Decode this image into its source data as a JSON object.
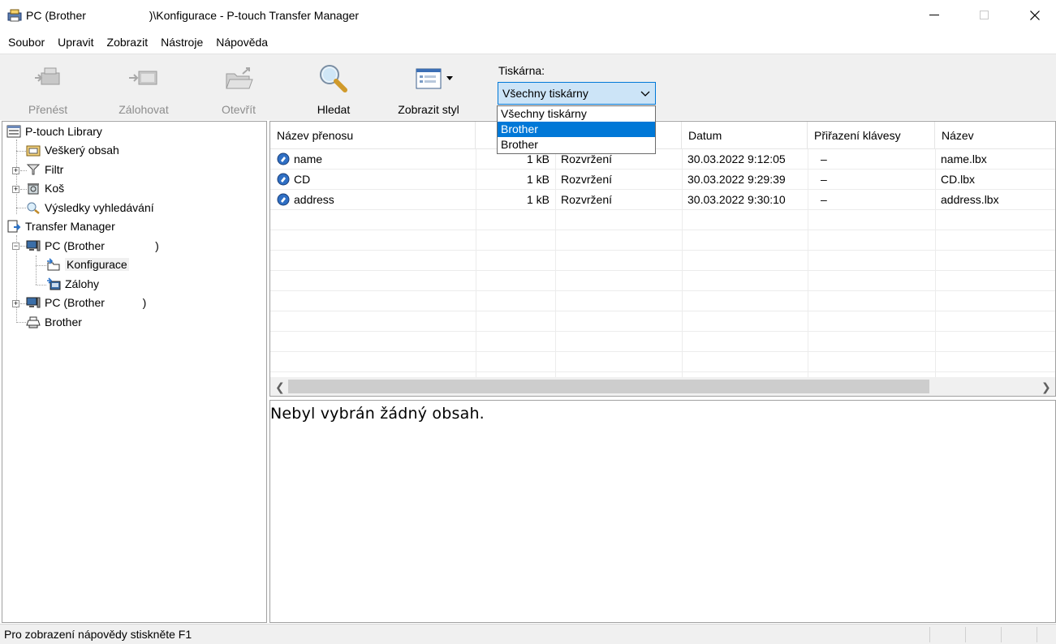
{
  "window": {
    "title_prefix": "PC (Brother",
    "title_suffix": ")\\Konfigurace - P-touch Transfer Manager"
  },
  "menu": [
    "Soubor",
    "Upravit",
    "Zobrazit",
    "Nástroje",
    "Nápověda"
  ],
  "toolbar": {
    "transfer": "Přenést",
    "backup": "Zálohovat",
    "open": "Otevřít",
    "search": "Hledat",
    "view_style": "Zobrazit styl",
    "printer_label": "Tiskárna:",
    "printer_selected": "Všechny tiskárny",
    "printer_options": [
      "Všechny tiskárny",
      "Brother",
      "Brother"
    ],
    "printer_highlighted_index": 1
  },
  "tree": {
    "library": "P-touch Library",
    "all_content": "Veškerý obsah",
    "filter": "Filtr",
    "trash": "Koš",
    "search_results": "Výsledky vyhledávání",
    "transfer_manager": "Transfer Manager",
    "pc1": "PC (Brother                )",
    "configurations": "Konfigurace",
    "backups": "Zálohy",
    "pc2": "PC (Brother            )",
    "brother": "Brother"
  },
  "list": {
    "columns": [
      "Název přenosu",
      "",
      "",
      "Datum",
      "Přiřazení klávesy",
      "Název"
    ],
    "rows": [
      {
        "name": "name",
        "size": "1 kB",
        "type": "Rozvržení",
        "date": "30.03.2022 9:12:05",
        "key": "–",
        "file": "name.lbx"
      },
      {
        "name": "CD",
        "size": "1 kB",
        "type": "Rozvržení",
        "date": "30.03.2022 9:29:39",
        "key": "–",
        "file": "CD.lbx"
      },
      {
        "name": "address",
        "size": "1 kB",
        "type": "Rozvržení",
        "date": "30.03.2022 9:30:10",
        "key": "–",
        "file": "address.lbx"
      }
    ]
  },
  "preview": {
    "empty_text": "Nebyl vybrán žádný obsah."
  },
  "status": {
    "help_text": "Pro zobrazení nápovědy stiskněte F1"
  },
  "colors": {
    "accent": "#0078d7",
    "selection_bg": "#cce4f7",
    "toolbar_bg": "#f0f0f0"
  }
}
